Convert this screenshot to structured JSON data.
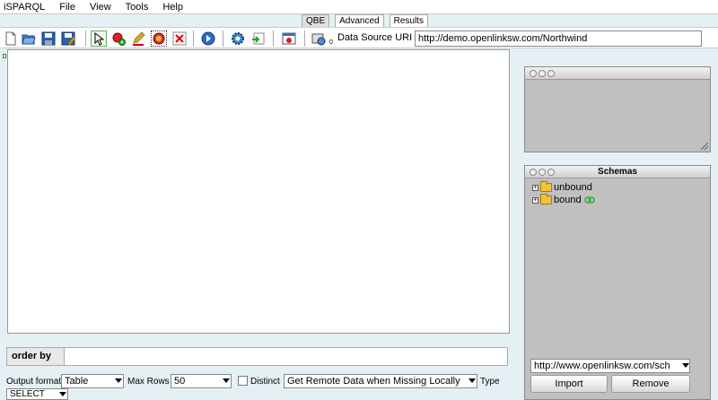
{
  "menubar": {
    "items": [
      {
        "label": "iSPARQL"
      },
      {
        "label": "File"
      },
      {
        "label": "View"
      },
      {
        "label": "Tools"
      },
      {
        "label": "Help"
      }
    ]
  },
  "tabs": [
    {
      "label": "QBE",
      "active": true
    },
    {
      "label": "Advanced",
      "active": false
    },
    {
      "label": "Results",
      "active": false
    }
  ],
  "toolbar": {
    "icons": [
      "new-icon",
      "open-icon",
      "save-icon",
      "save-as-icon",
      "select-pointer-icon",
      "add-node-icon",
      "edit-pencil-icon",
      "connect-icon",
      "delete-icon",
      "run-icon",
      "settings-icon",
      "import-icon",
      "query-icon",
      "datasource-icon"
    ],
    "datasource_sub": "0",
    "datasource_label": "Data Source URI",
    "datasource_value": "http://demo.openlinksw.com/Northwind"
  },
  "orderby": {
    "label": "order by",
    "value": ""
  },
  "bottom": {
    "output_format_label": "Output format",
    "output_format_value": "Table",
    "max_rows_label": "Max Rows",
    "max_rows_value": "50",
    "distinct_label": "Distinct",
    "distinct_checked": false,
    "remote_value": "Get Remote Data when Missing Locally",
    "type_label": "Type",
    "type_value": "SELECT"
  },
  "top_panel": {
    "title": ""
  },
  "schemas_panel": {
    "title": "Schemas",
    "items": [
      {
        "label": "unbound"
      },
      {
        "label": "bound"
      }
    ],
    "url_value": "http://www.openlinksw.com/sch",
    "import_label": "Import",
    "remove_label": "Remove"
  }
}
